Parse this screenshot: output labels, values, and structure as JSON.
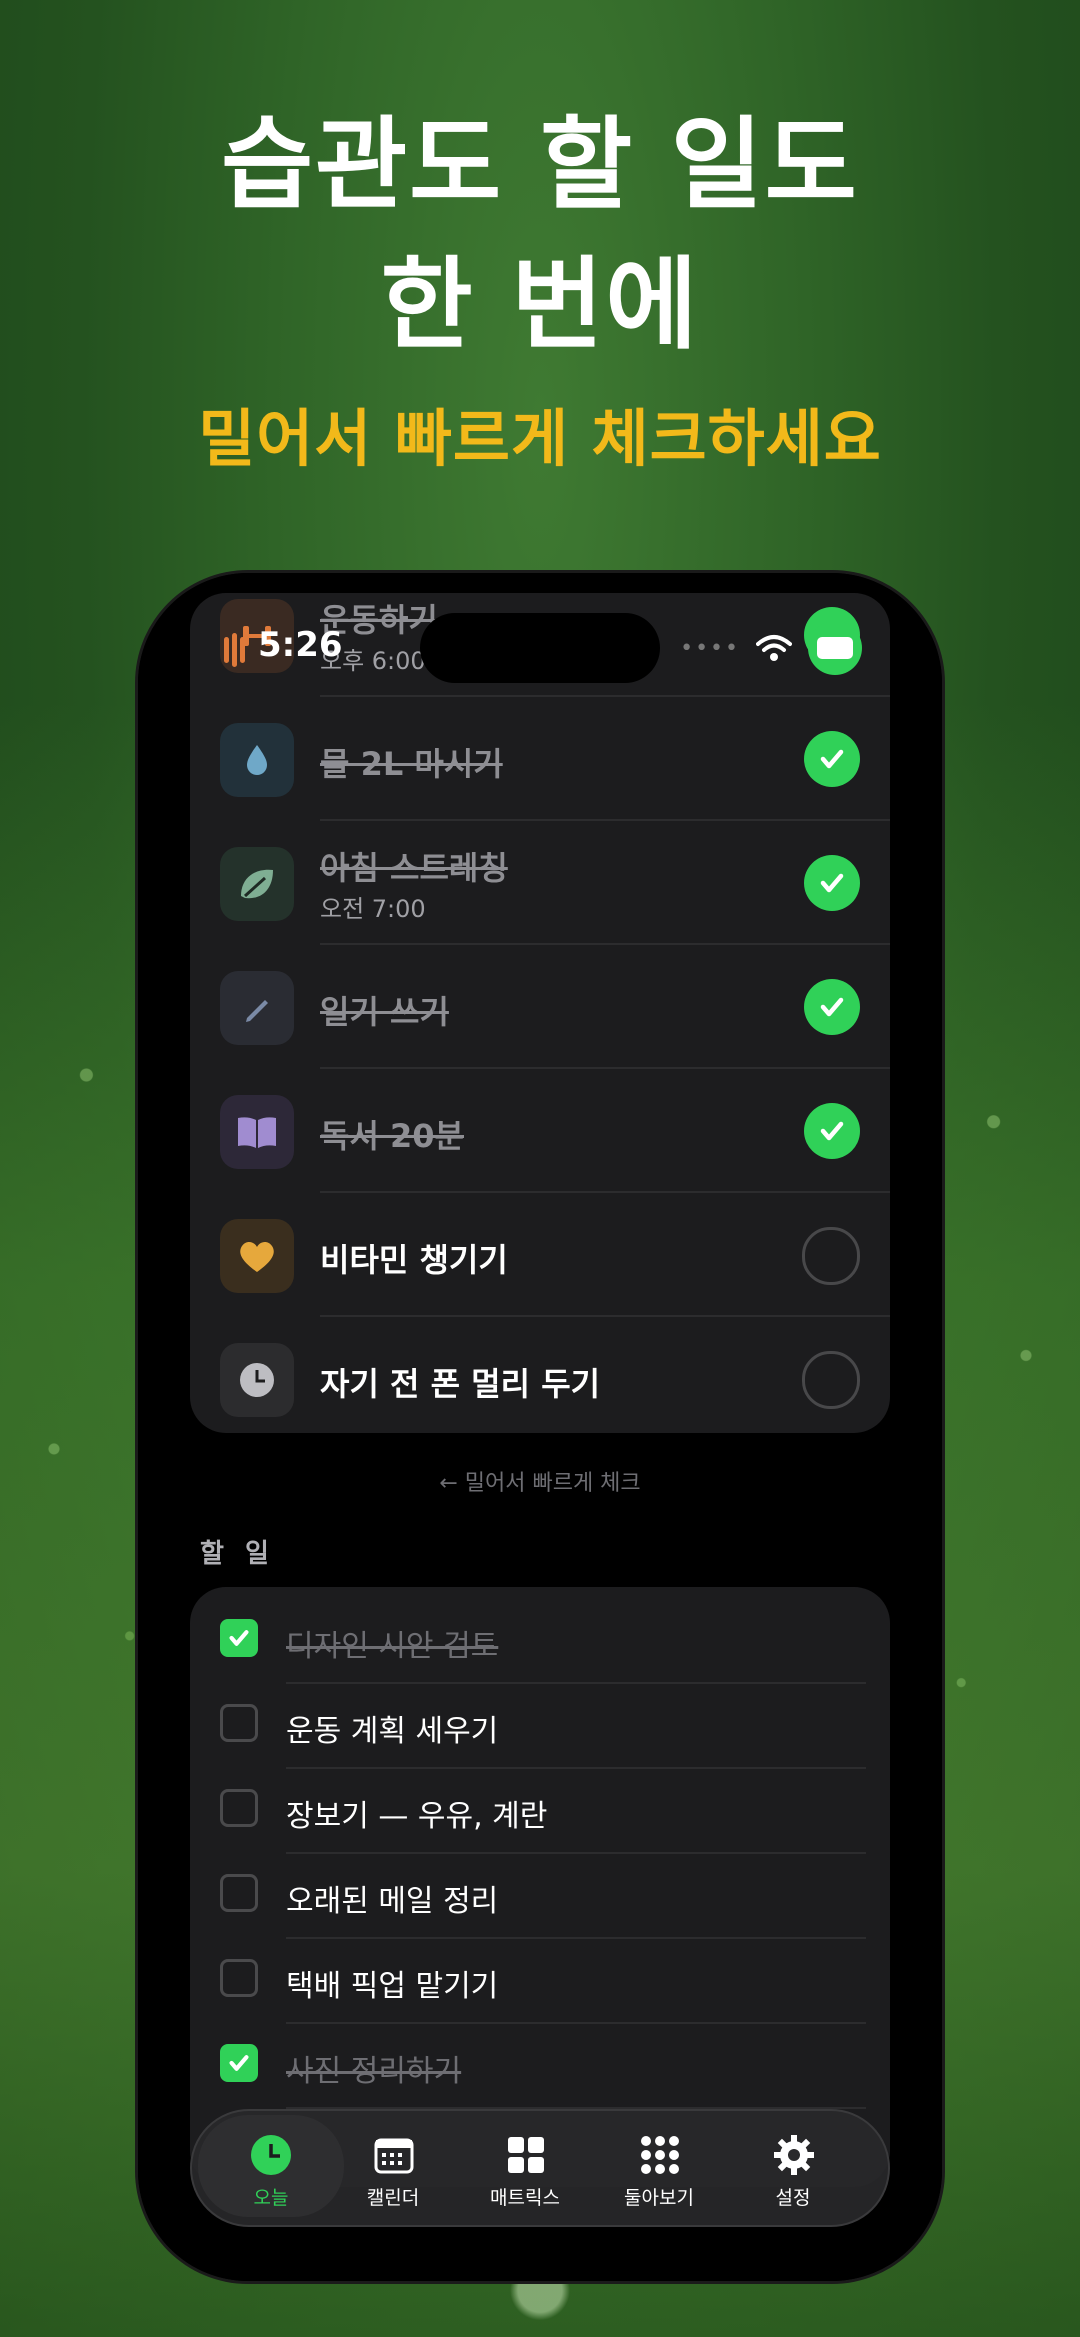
{
  "headline": {
    "line1": "습관도 할 일도",
    "line2": "한 번에",
    "subtitle": "밀어서 빠르게 체크하세요"
  },
  "accent_colors": {
    "yellow": "#f2b91a",
    "green": "#30d158"
  },
  "status_bar": {
    "time": "5:26"
  },
  "habits": [
    {
      "title": "운동하기",
      "sub": "오후 6:00",
      "done": true,
      "icon": "dumbbell-icon"
    },
    {
      "title": "물 2L 마시기",
      "sub": "",
      "done": true,
      "icon": "water-drop-icon"
    },
    {
      "title": "아침 스트레칭",
      "sub": "오전 7:00",
      "done": true,
      "icon": "leaf-icon"
    },
    {
      "title": "일기 쓰기",
      "sub": "",
      "done": true,
      "icon": "pencil-icon"
    },
    {
      "title": "독서 20분",
      "sub": "",
      "done": true,
      "icon": "book-icon"
    },
    {
      "title": "비타민 챙기기",
      "sub": "",
      "done": false,
      "icon": "heart-icon"
    },
    {
      "title": "자기 전 폰 멀리 두기",
      "sub": "",
      "done": false,
      "icon": "clock-icon"
    }
  ],
  "swipe_hint": "← 밀어서 빠르게 체크",
  "todo_section_title": "할 일",
  "todos": [
    {
      "text": "디자인 시안 검토",
      "done": true
    },
    {
      "text": "운동 계획 세우기",
      "done": false
    },
    {
      "text": "장보기 — 우유, 계란",
      "done": false
    },
    {
      "text": "오래된 메일 정리",
      "done": false
    },
    {
      "text": "택배 픽업 맡기기",
      "done": false
    },
    {
      "text": "사진 정리하기",
      "done": true
    }
  ],
  "tabs": [
    {
      "label": "오늘",
      "icon": "clock-icon",
      "active": true
    },
    {
      "label": "캘린더",
      "icon": "calendar-icon",
      "active": false
    },
    {
      "label": "매트릭스",
      "icon": "grid-icon",
      "active": false
    },
    {
      "label": "둘아보기",
      "icon": "dots-grid-icon",
      "active": false
    },
    {
      "label": "설정",
      "icon": "gear-icon",
      "active": false
    }
  ]
}
